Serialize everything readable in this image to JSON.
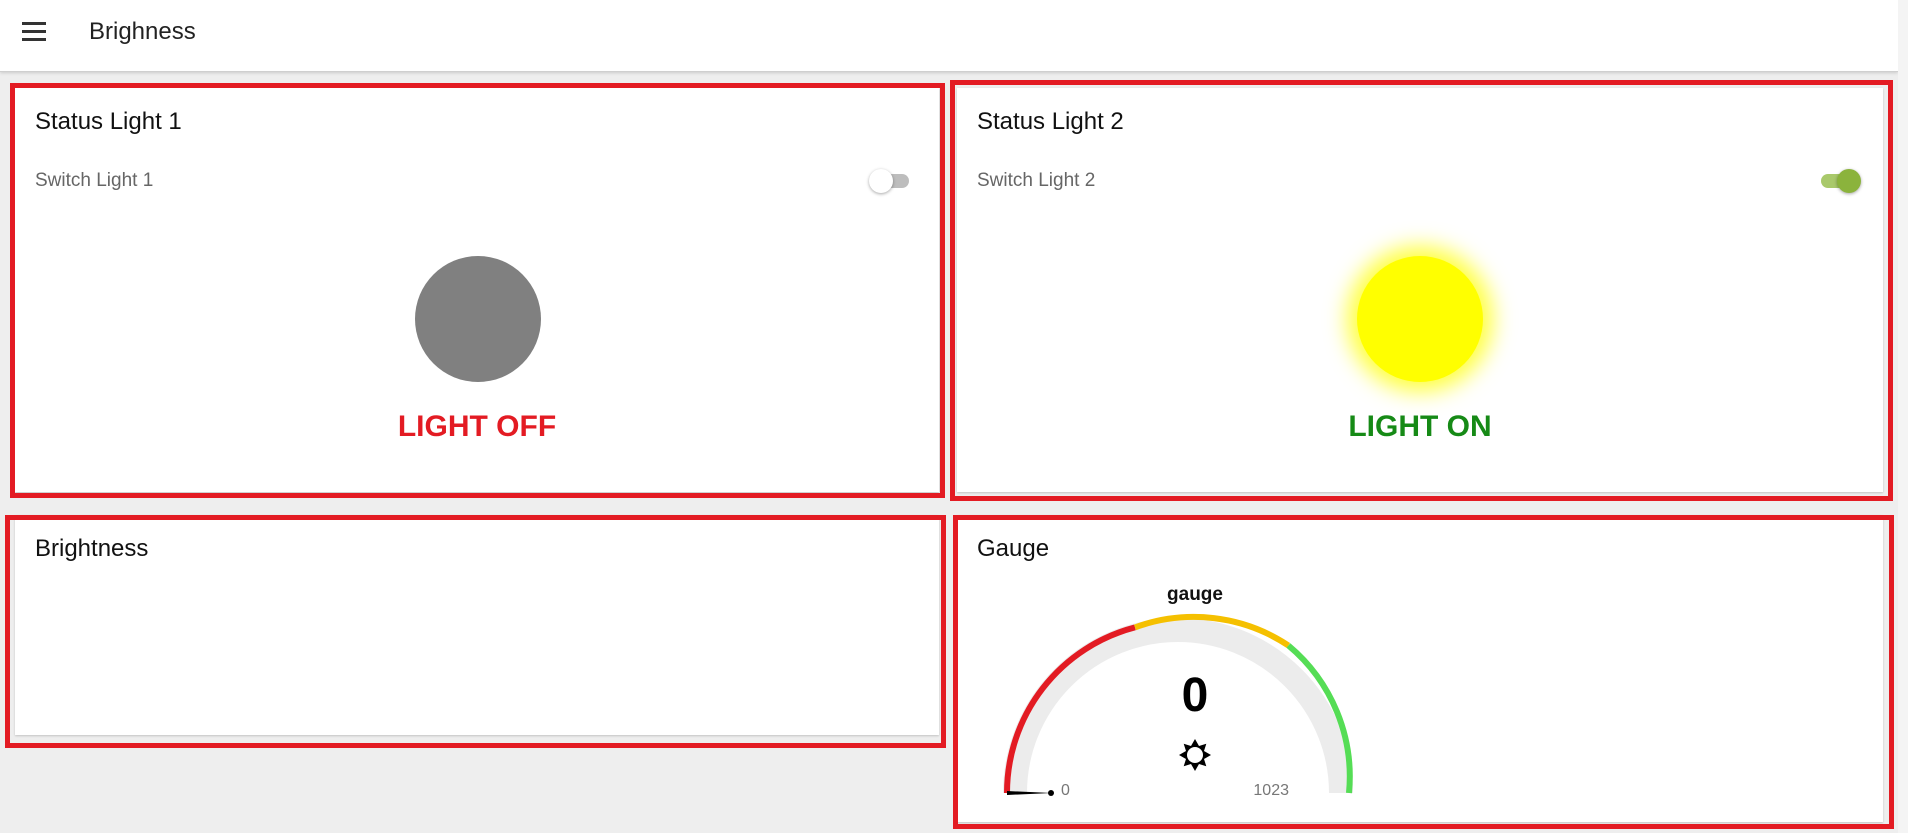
{
  "header": {
    "menu_icon": "hamburger-menu-icon",
    "title": "Brighness"
  },
  "status_light_1": {
    "title": "Status Light 1",
    "switch_label": "Switch Light 1",
    "switch_on": false,
    "lamp_color": "#808080",
    "status_text": "LIGHT OFF",
    "status_color": "#e31b23"
  },
  "status_light_2": {
    "title": "Status Light 2",
    "switch_label": "Switch Light 2",
    "switch_on": true,
    "lamp_color": "#ffff00",
    "status_text": "LIGHT ON",
    "status_color": "#168a16"
  },
  "brightness": {
    "title": "Brightness"
  },
  "gauge_card": {
    "title": "Gauge",
    "gauge_label": "gauge",
    "value": "0",
    "min": "0",
    "max": "1023",
    "icon": "sun-icon",
    "segment_colors": [
      "#e31b23",
      "#f5c000",
      "#55dd55"
    ]
  },
  "colors": {
    "highlight_border": "#e31b23",
    "background": "#eeeeee"
  }
}
